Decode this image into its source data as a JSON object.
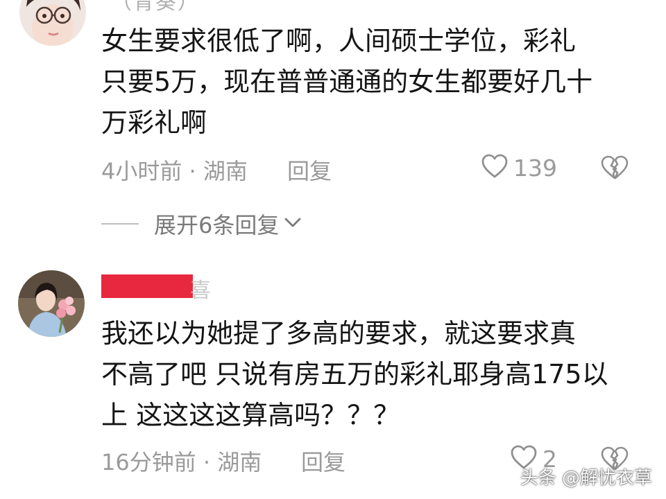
{
  "comments": [
    {
      "author_partial": "（青葵）",
      "text_lines": [
        "女生要求很低了啊，人间硕士学位，彩礼",
        "只要5万，现在普普通通的女生都要好几十",
        "万彩礼啊"
      ],
      "meta": "4小时前 · 湖南",
      "reply_label": "回复",
      "like_count": "139",
      "expand_label": "展开6条回复"
    },
    {
      "author_partial": "喜",
      "text_lines": [
        "我还以为她提了多高的要求，就这要求真",
        "不高了吧 只说有房五万的彩礼耶身高175以",
        "上 这这这这算高吗？？？"
      ],
      "meta": "16分钟前 · 湖南",
      "reply_label": "回复",
      "like_count": "2"
    }
  ],
  "watermark": "头条 @解忧衣草",
  "colors": {
    "text": "#141414",
    "meta": "#9a9a9a",
    "redaction": "#e8283f"
  },
  "icons": [
    "heart-outline-icon",
    "broken-heart-icon",
    "chevron-down-icon"
  ]
}
